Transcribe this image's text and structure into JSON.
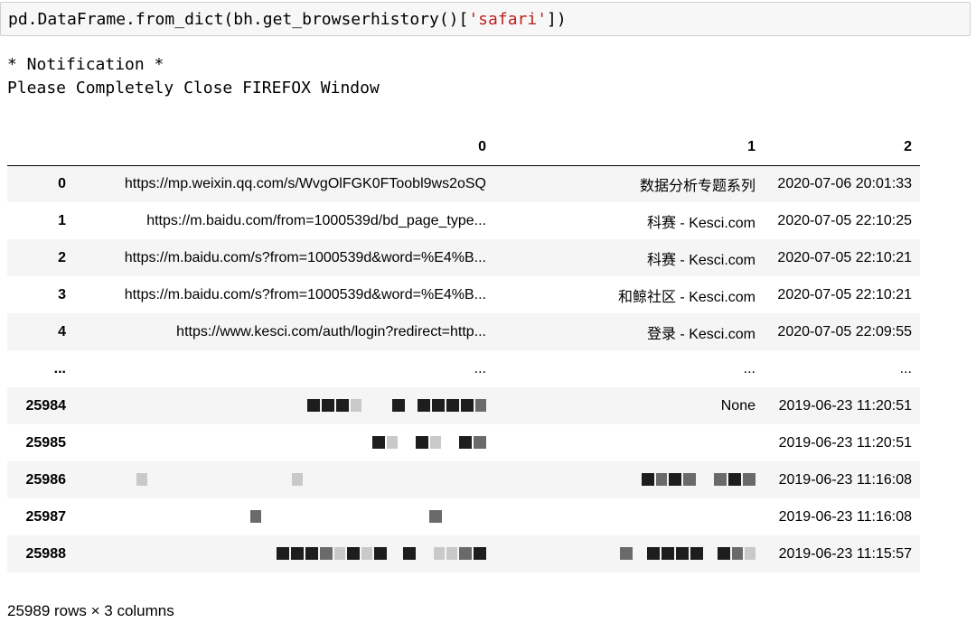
{
  "code": {
    "prefix": "pd.DataFrame.from_dict(bh.get_browserhistory()[",
    "string_arg": "'safari'",
    "suffix": "])"
  },
  "output_text": "* Notification *\nPlease Completely Close FIREFOX Window",
  "table": {
    "columns": [
      "",
      "0",
      "1",
      "2"
    ],
    "rows": [
      {
        "index": "0",
        "url": "https://mp.weixin.qq.com/s/WvgOlFGK0FToobl9ws2oSQ",
        "title": "数据分析专题系列",
        "time": "2020-07-06 20:01:33"
      },
      {
        "index": "1",
        "url": "https://m.baidu.com/from=1000539d/bd_page_type...",
        "title": "科赛 - Kesci.com",
        "time": "2020-07-05 22:10:25"
      },
      {
        "index": "2",
        "url": "https://m.baidu.com/s?from=1000539d&word=%E4%B...",
        "title": "科赛 - Kesci.com",
        "time": "2020-07-05 22:10:21"
      },
      {
        "index": "3",
        "url": "https://m.baidu.com/s?from=1000539d&word=%E4%B...",
        "title": "和鲸社区 - Kesci.com",
        "time": "2020-07-05 22:10:21"
      },
      {
        "index": "4",
        "url": "https://www.kesci.com/auth/login?redirect=http...",
        "title": "登录 - Kesci.com",
        "time": "2020-07-05 22:09:55"
      },
      {
        "index": "...",
        "url": "...",
        "title": "...",
        "time": "..."
      },
      {
        "index": "25984",
        "url": "",
        "title": "None",
        "time": "2019-06-23 11:20:51"
      },
      {
        "index": "25985",
        "url": "",
        "title": "",
        "time": "2019-06-23 11:20:51"
      },
      {
        "index": "25986",
        "url": "",
        "title": "",
        "time": "2019-06-23 11:16:08"
      },
      {
        "index": "25987",
        "url": "",
        "title": "",
        "time": "2019-06-23 11:16:08"
      },
      {
        "index": "25988",
        "url": "",
        "title": "",
        "time": "2019-06-23 11:15:57"
      }
    ]
  },
  "footer": "25989 rows × 3 columns"
}
